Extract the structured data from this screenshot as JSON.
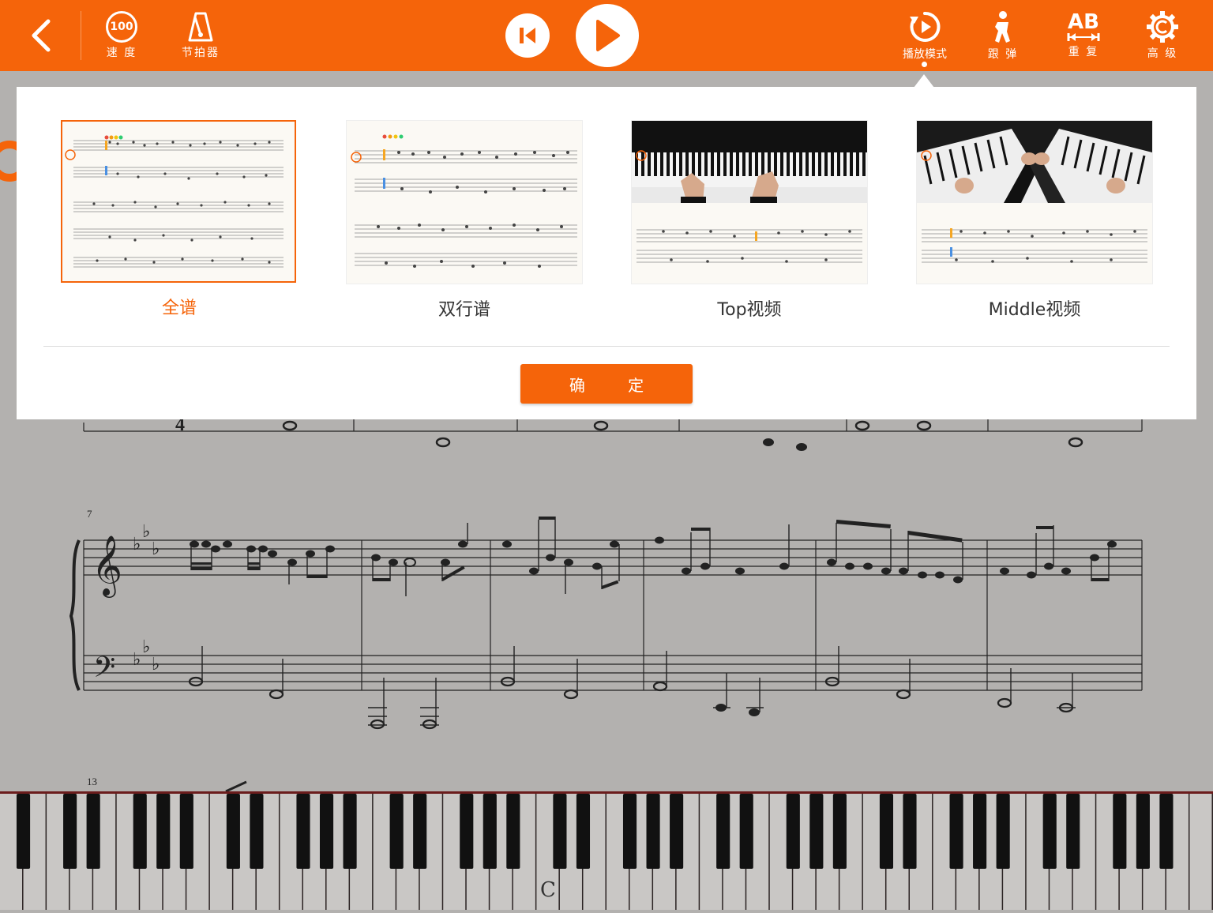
{
  "toolbar": {
    "speed_value": "100",
    "speed_label": "速 度",
    "metronome_label": "节拍器",
    "play_mode_label": "播放模式",
    "follow_label": "跟 弹",
    "repeat_icon_text": "AB",
    "repeat_label": "重 复",
    "advanced_label": "高 级"
  },
  "popup": {
    "options": [
      {
        "label": "全谱",
        "selected": true
      },
      {
        "label": "双行谱",
        "selected": false
      },
      {
        "label": "Top视频",
        "selected": false
      },
      {
        "label": "Middle视频",
        "selected": false
      }
    ],
    "confirm_label": "确 定"
  },
  "sheet": {
    "measure_number_7": "7",
    "measure_number_13": "13"
  },
  "keyboard": {
    "middle_c_label": "C"
  },
  "colors": {
    "accent": "#f5640a",
    "background": "#b3b1af"
  }
}
